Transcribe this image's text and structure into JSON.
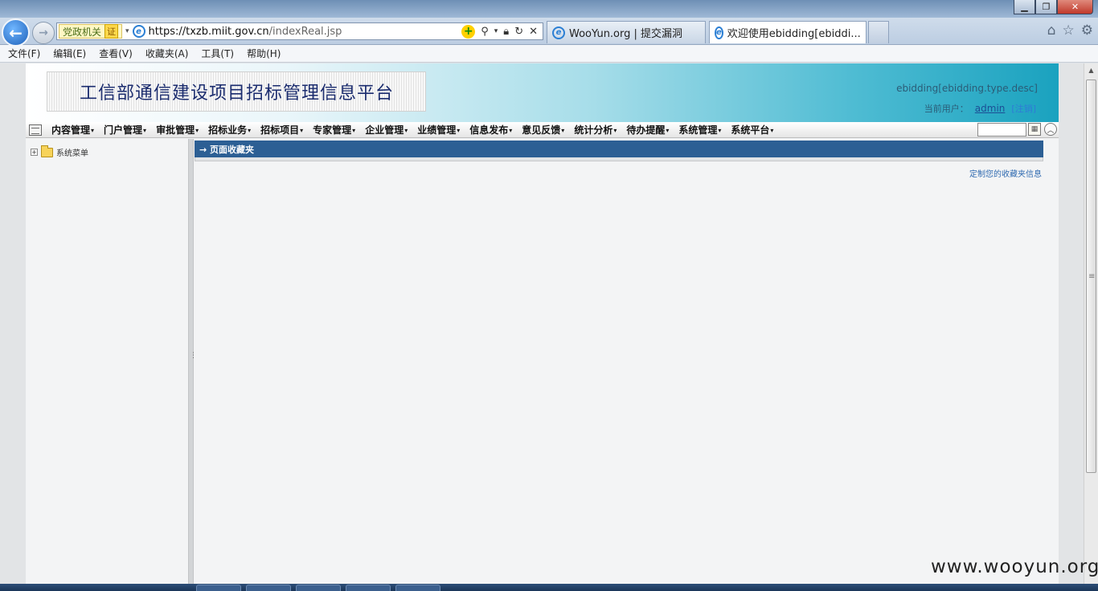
{
  "browser": {
    "window_controls": [
      "▁",
      "❐",
      "✕"
    ],
    "address_zone": "党政机关",
    "address_zone_badge": "证",
    "url_main": "https://txzb.miit.gov.cn",
    "url_path": "/indexReal.jsp",
    "tabs": [
      {
        "title": "WooYun.org | 提交漏洞",
        "active": false
      },
      {
        "title": "欢迎使用ebidding[ebiddi...",
        "active": true
      }
    ],
    "menu": [
      "文件(F)",
      "编辑(E)",
      "查看(V)",
      "收藏夹(A)",
      "工具(T)",
      "帮助(H)"
    ]
  },
  "header": {
    "site_title": "工信部通信建设项目招标管理信息平台",
    "system_desc": "ebidding[ebidding.type.desc]",
    "current_user_label": "当前用户：",
    "username": "admin",
    "logout_label": "[注销]"
  },
  "nav": {
    "items": [
      "内容管理",
      "门户管理",
      "审批管理",
      "招标业务",
      "招标项目",
      "专家管理",
      "企业管理",
      "业绩管理",
      "信息发布",
      "意见反馈",
      "统计分析",
      "待办提醒",
      "系统管理",
      "系统平台"
    ]
  },
  "sidebar": {
    "tree_root_label": "系统菜单"
  },
  "content": {
    "section_title": "→ 页面收藏夹",
    "customize_link": "定制您的收藏夹信息"
  },
  "watermark": "www.wooyun.org",
  "colors": {
    "nav_blue_bar": "#2c5f94",
    "banner_end": "#1aa2bf",
    "title_text": "#1a2b6e"
  }
}
